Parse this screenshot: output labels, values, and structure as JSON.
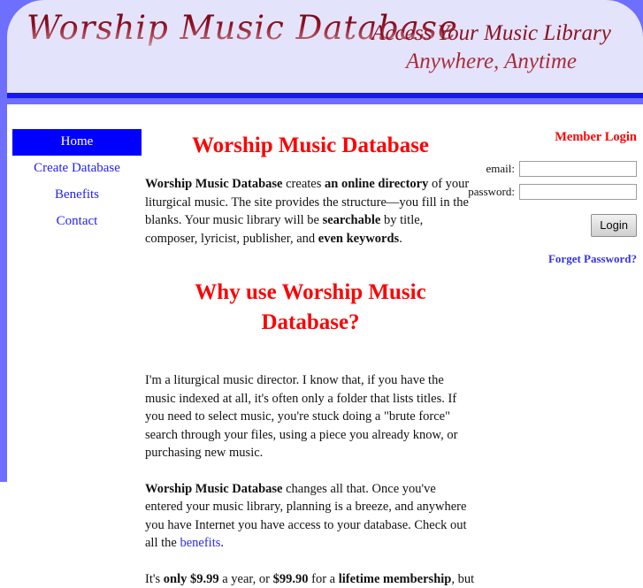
{
  "theme": {
    "band_blue": "#6e6eff",
    "header_bg": "#e3e3fb",
    "header_rule": "#1717f0",
    "heading_red": "#fb0505",
    "logo_red": "#8e1225",
    "link_blue": "#2a2ae8",
    "nav_active_bg": "#0000ff"
  },
  "header": {
    "logo_text": "Worship Music Database",
    "tagline_line1": "Access Your Music Library",
    "tagline_line2": "Anywhere, Anytime"
  },
  "nav": {
    "items": [
      {
        "label": "Home",
        "active": true
      },
      {
        "label": "Create Database",
        "active": false
      },
      {
        "label": "Benefits",
        "active": false
      },
      {
        "label": "Contact",
        "active": false
      }
    ]
  },
  "content": {
    "page_heading": "Worship Music Database",
    "section_heading_line1": "Why use Worship Music",
    "section_heading_line2": "Database?",
    "intro": {
      "brand": "Worship Music Database",
      "t1": " creates ",
      "emphasis1": "an online directory",
      "t2": " of your liturgical music. The site provides the structure—you fill in the blanks. Your music library will be ",
      "emphasis2": "searchable",
      "t3": " by title, composer, lyricist, publisher, and ",
      "emphasis3": "even keywords",
      "t4": "."
    },
    "story": "I'm a liturgical music director. I know that, if you have the music indexed at all, it's often only a folder that lists titles. If you need to select music, you're stuck doing a \"brute force\" search through your files, using a piece you already know, or purchasing new music.",
    "solution": {
      "brand": "Worship Music Database",
      "t1": " changes all that. Once you've entered your music library, planning is a breeze, and anywhere you have Internet you have access to your database. Check out all the ",
      "link": "benefits",
      "t2": "."
    },
    "price": {
      "t1": "It's ",
      "emphasis1": "only $9.99",
      "t2": " a year, or ",
      "emphasis2": "$99.90",
      "t3": " for a ",
      "emphasis3": "lifetime membership",
      "t4": ", but"
    }
  },
  "login": {
    "title": "Member Login",
    "email_label": "email:",
    "email_value": "",
    "email_placeholder": "",
    "password_label": "password:",
    "password_value": "",
    "password_placeholder": "",
    "button_label": "Login",
    "forget_label": "Forget Password?"
  }
}
